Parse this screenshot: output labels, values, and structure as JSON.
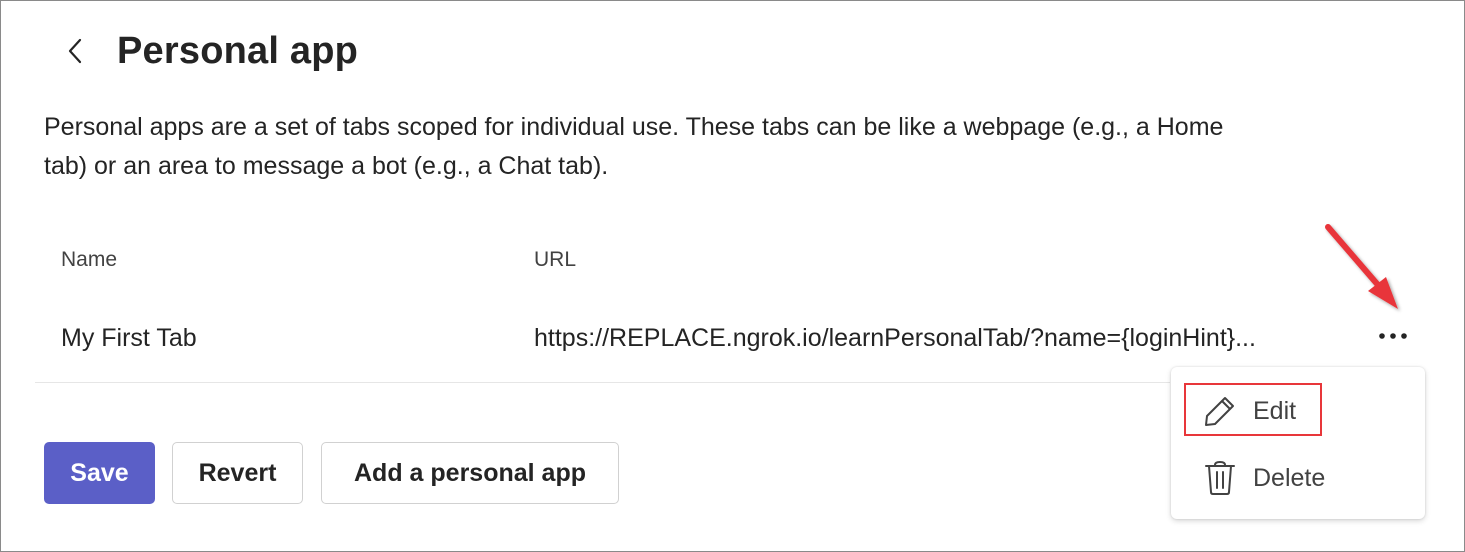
{
  "header": {
    "back_icon": "chevron-left-icon",
    "title": "Personal app"
  },
  "description": "Personal apps are a set of tabs scoped for individual use. These tabs can be like a webpage (e.g., a Home tab) or an area to message a bot (e.g., a Chat tab).",
  "table": {
    "columns": [
      "Name",
      "URL"
    ],
    "rows": [
      {
        "name": "My First Tab",
        "url": "https://REPLACE.ngrok.io/learnPersonalTab/?name={loginHint}..."
      }
    ],
    "row_actions_icon": "more-horizontal-icon"
  },
  "context_menu": {
    "items": [
      {
        "label": "Edit",
        "icon": "pencil-icon",
        "highlighted": true
      },
      {
        "label": "Delete",
        "icon": "trash-icon"
      }
    ]
  },
  "buttons": {
    "save": "Save",
    "revert": "Revert",
    "add": "Add a personal app"
  },
  "colors": {
    "primary": "#5b5fc7",
    "annotation": "#e8363a",
    "text": "#242424"
  }
}
